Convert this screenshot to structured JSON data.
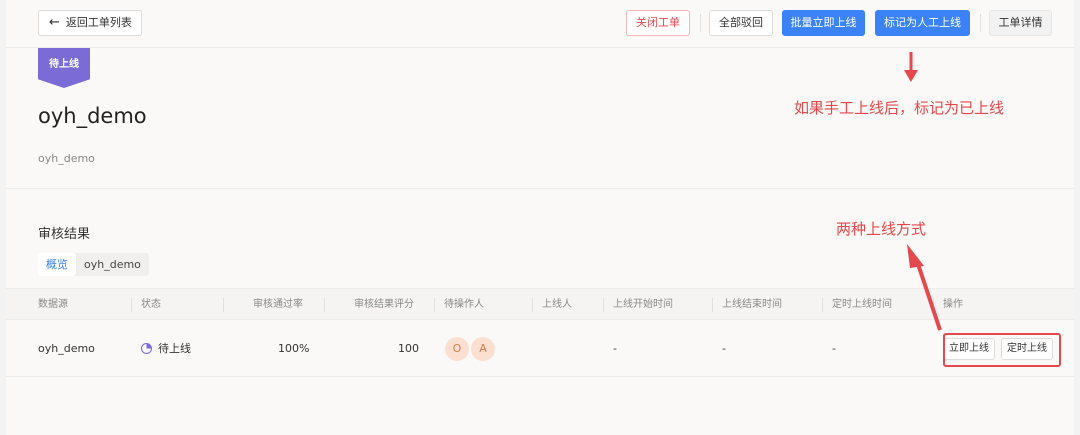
{
  "toolbar": {
    "back_label": "返回工单列表",
    "close_label": "关闭工单",
    "reject_all_label": "全部驳回",
    "batch_online_label": "批量立即上线",
    "mark_manual_label": "标记为人工上线",
    "detail_label": "工单详情",
    "primary_color": "#3b82f6",
    "danger_color": "#e5484d"
  },
  "status_badge": {
    "label": "待上线",
    "color": "#7b6bd6"
  },
  "ticket": {
    "title": "oyh_demo",
    "description": "oyh_demo"
  },
  "review": {
    "section_title": "审核结果",
    "tabs": [
      {
        "label": "概览",
        "active": true
      },
      {
        "label": "oyh_demo",
        "active": false
      }
    ]
  },
  "table": {
    "headers": [
      "数据源",
      "状态",
      "审核通过率",
      "审核结果评分",
      "待操作人",
      "上线人",
      "上线开始时间",
      "上线结束时间",
      "定时上线时间",
      "操作"
    ],
    "rows": [
      {
        "datasource": "oyh_demo",
        "status": "待上线",
        "pass_rate": "100%",
        "score": "100",
        "pending_operators": [
          "O",
          "A"
        ],
        "online_user": "",
        "start_time": "-",
        "end_time": "-",
        "scheduled_time": "-",
        "actions": [
          "立即上线",
          "定时上线"
        ]
      }
    ]
  },
  "annotations": {
    "note_mark": "如果手工上线后，标记为已上线",
    "note_methods": "两种上线方式",
    "color": "#e5484d"
  }
}
